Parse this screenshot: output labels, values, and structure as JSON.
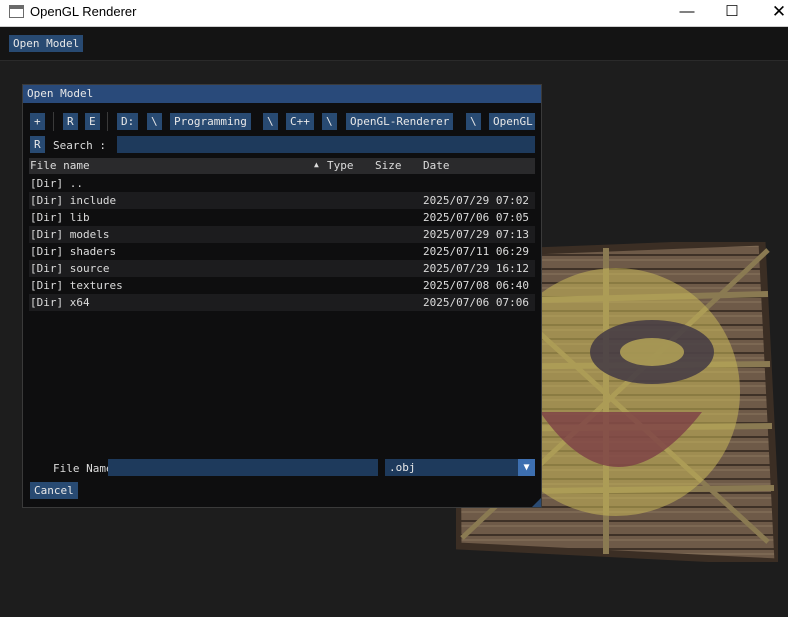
{
  "window": {
    "title": "OpenGL Renderer",
    "minimize": "—",
    "maximize": "☐",
    "close": "✕"
  },
  "menubar": {
    "open_model": "Open Model"
  },
  "dialog": {
    "title": "Open Model",
    "toolbar": {
      "new_dir": "+",
      "rename": "R",
      "edit": "E",
      "path": [
        "D:",
        "\\",
        "Programming",
        "\\",
        "C++",
        "\\",
        "OpenGL-Renderer",
        "\\",
        "OpenGL"
      ]
    },
    "search": {
      "reset": "R",
      "label": "Search :",
      "value": ""
    },
    "columns": {
      "name": "File name",
      "type": "Type",
      "size": "Size",
      "date": "Date",
      "sort_indicator": "▲"
    },
    "rows": [
      {
        "name": "[Dir] ..",
        "date": ""
      },
      {
        "name": "[Dir] include",
        "date": "2025/07/29 07:02"
      },
      {
        "name": "[Dir] lib",
        "date": "2025/07/06 07:05"
      },
      {
        "name": "[Dir] models",
        "date": "2025/07/29 07:13"
      },
      {
        "name": "[Dir] shaders",
        "date": "2025/07/11 06:29"
      },
      {
        "name": "[Dir] source",
        "date": "2025/07/29 16:12"
      },
      {
        "name": "[Dir] textures",
        "date": "2025/07/08 06:40"
      },
      {
        "name": "[Dir] x64",
        "date": "2025/07/06 07:06"
      }
    ],
    "file_name": {
      "label": "File Name:",
      "value": ""
    },
    "filter": {
      "selected": ".obj"
    },
    "cancel": "Cancel"
  }
}
